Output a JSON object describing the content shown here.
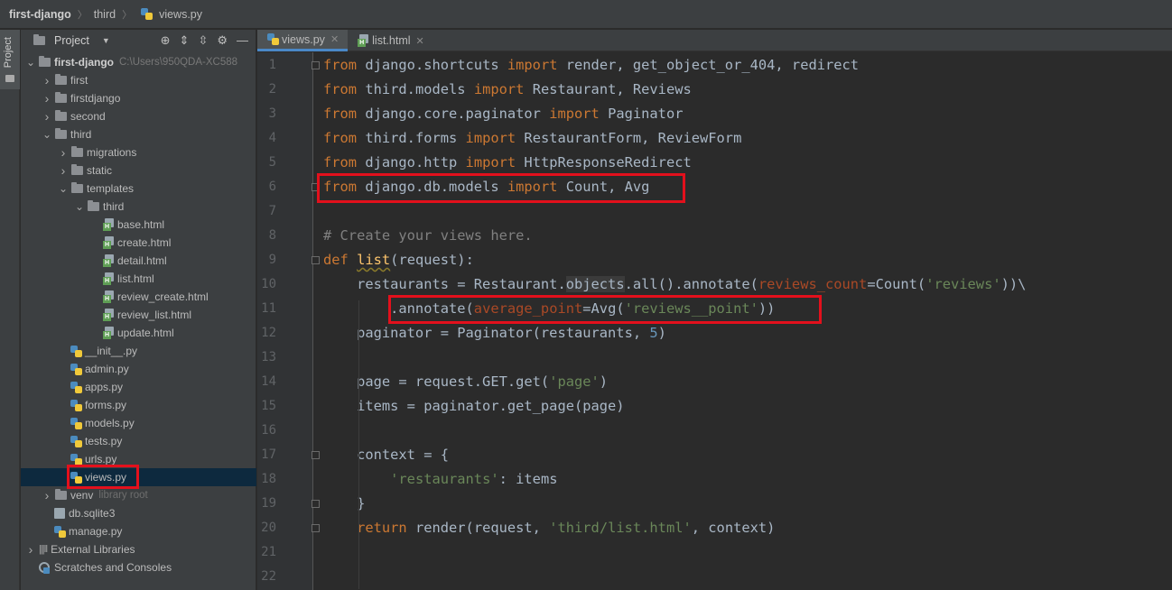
{
  "breadcrumb": {
    "project": "first-django",
    "folder": "third",
    "file": "views.py"
  },
  "side_strip": {
    "project_label": "Project"
  },
  "project_panel": {
    "title": "Project",
    "tree": [
      {
        "label": "first-django",
        "extra": "C:\\Users\\950QDA-XC588",
        "type": "folder",
        "level": 0,
        "open": true
      },
      {
        "label": "first",
        "type": "folder",
        "level": 1
      },
      {
        "label": "firstdjango",
        "type": "folder",
        "level": 1
      },
      {
        "label": "second",
        "type": "folder",
        "level": 1
      },
      {
        "label": "third",
        "type": "folder",
        "level": 1,
        "open": true
      },
      {
        "label": "migrations",
        "type": "folder",
        "level": 2
      },
      {
        "label": "static",
        "type": "folder",
        "level": 2
      },
      {
        "label": "templates",
        "type": "folder",
        "level": 2,
        "open": true
      },
      {
        "label": "third",
        "type": "folder",
        "level": 3,
        "open": true
      },
      {
        "label": "base.html",
        "type": "html",
        "level": 4
      },
      {
        "label": "create.html",
        "type": "html",
        "level": 4
      },
      {
        "label": "detail.html",
        "type": "html",
        "level": 4
      },
      {
        "label": "list.html",
        "type": "html",
        "level": 4
      },
      {
        "label": "review_create.html",
        "type": "html",
        "level": 4
      },
      {
        "label": "review_list.html",
        "type": "html",
        "level": 4
      },
      {
        "label": "update.html",
        "type": "html",
        "level": 4
      },
      {
        "label": "__init__.py",
        "type": "py",
        "level": 2
      },
      {
        "label": "admin.py",
        "type": "py",
        "level": 2
      },
      {
        "label": "apps.py",
        "type": "py",
        "level": 2
      },
      {
        "label": "forms.py",
        "type": "py",
        "level": 2
      },
      {
        "label": "models.py",
        "type": "py",
        "level": 2
      },
      {
        "label": "tests.py",
        "type": "py",
        "level": 2
      },
      {
        "label": "urls.py",
        "type": "py",
        "level": 2
      },
      {
        "label": "views.py",
        "type": "py",
        "level": 2,
        "selected": true
      },
      {
        "label": "venv",
        "extra": "library root",
        "type": "folder",
        "level": 1
      },
      {
        "label": "db.sqlite3",
        "type": "db",
        "level": 1
      },
      {
        "label": "manage.py",
        "type": "py",
        "level": 1
      },
      {
        "label": "External Libraries",
        "type": "lib",
        "level": 0
      },
      {
        "label": "Scratches and Consoles",
        "type": "scratch",
        "level": 0
      }
    ]
  },
  "tabs": [
    {
      "label": "views.py",
      "active": true
    },
    {
      "label": "list.html",
      "active": false
    }
  ],
  "line_numbers": [
    "1",
    "2",
    "3",
    "4",
    "5",
    "6",
    "7",
    "8",
    "9",
    "10",
    "11",
    "12",
    "13",
    "14",
    "15",
    "16",
    "17",
    "18",
    "19",
    "20",
    "21",
    "22"
  ],
  "code": [
    [
      [
        "kw",
        "from"
      ],
      [
        "tx",
        " django.shortcuts "
      ],
      [
        "kw",
        "import"
      ],
      [
        "tx",
        " render, get_object_or_404, redirect"
      ]
    ],
    [
      [
        "kw",
        "from"
      ],
      [
        "tx",
        " third.models "
      ],
      [
        "kw",
        "import"
      ],
      [
        "tx",
        " Restaurant, Reviews"
      ]
    ],
    [
      [
        "kw",
        "from"
      ],
      [
        "tx",
        " django.core.paginator "
      ],
      [
        "kw",
        "import"
      ],
      [
        "tx",
        " Paginator"
      ]
    ],
    [
      [
        "kw",
        "from"
      ],
      [
        "tx",
        " third.forms "
      ],
      [
        "kw",
        "import"
      ],
      [
        "tx",
        " RestaurantForm, ReviewForm"
      ]
    ],
    [
      [
        "kw",
        "from"
      ],
      [
        "tx",
        " django.http "
      ],
      [
        "kw",
        "import"
      ],
      [
        "tx",
        " HttpResponseRedirect"
      ]
    ],
    [
      [
        "kw",
        "from"
      ],
      [
        "tx",
        " django.db.models "
      ],
      [
        "kw",
        "import"
      ],
      [
        "tx",
        " Count, Avg"
      ]
    ],
    [],
    [
      [
        "cm",
        "# Create your views here."
      ]
    ],
    [
      [
        "kw",
        "def"
      ],
      [
        "tx",
        " "
      ],
      [
        "fn",
        "list"
      ],
      [
        "tx",
        "(request):"
      ]
    ],
    [
      [
        "tx",
        "    restaurants = Restaurant."
      ],
      [
        "obj",
        "objects"
      ],
      [
        "tx",
        ".all().annotate("
      ],
      [
        "prm",
        "reviews_count"
      ],
      [
        "tx",
        "=Count("
      ],
      [
        "st",
        "'reviews'"
      ],
      [
        "tx",
        "))\\"
      ]
    ],
    [
      [
        "tx",
        "        .annotate("
      ],
      [
        "prm",
        "average_point"
      ],
      [
        "tx",
        "=Avg("
      ],
      [
        "st",
        "'reviews__point'"
      ],
      [
        "tx",
        "))"
      ]
    ],
    [
      [
        "tx",
        "    paginator = Paginator(restaurants, "
      ],
      [
        "nm",
        "5"
      ],
      [
        "tx",
        ")"
      ]
    ],
    [],
    [
      [
        "tx",
        "    page = request.GET.get("
      ],
      [
        "st",
        "'page'"
      ],
      [
        "tx",
        ")"
      ]
    ],
    [
      [
        "tx",
        "    items = paginator.get_page(page)"
      ]
    ],
    [],
    [
      [
        "tx",
        "    context = {"
      ]
    ],
    [
      [
        "tx",
        "        "
      ],
      [
        "st",
        "'restaurants'"
      ],
      [
        "tx",
        ": items"
      ]
    ],
    [
      [
        "tx",
        "    }"
      ]
    ],
    [
      [
        "tx",
        "    "
      ],
      [
        "kw",
        "return"
      ],
      [
        "tx",
        " render(request, "
      ],
      [
        "st",
        "'third/list.html'"
      ],
      [
        "tx",
        ", context)"
      ]
    ],
    [],
    []
  ],
  "colors": {
    "keyword": "#cc7832",
    "string": "#6a8759",
    "number": "#6897bb",
    "comment": "#808080",
    "param": "#aa4926",
    "function": "#ffc66d",
    "annotation_box": "#e3101c"
  }
}
